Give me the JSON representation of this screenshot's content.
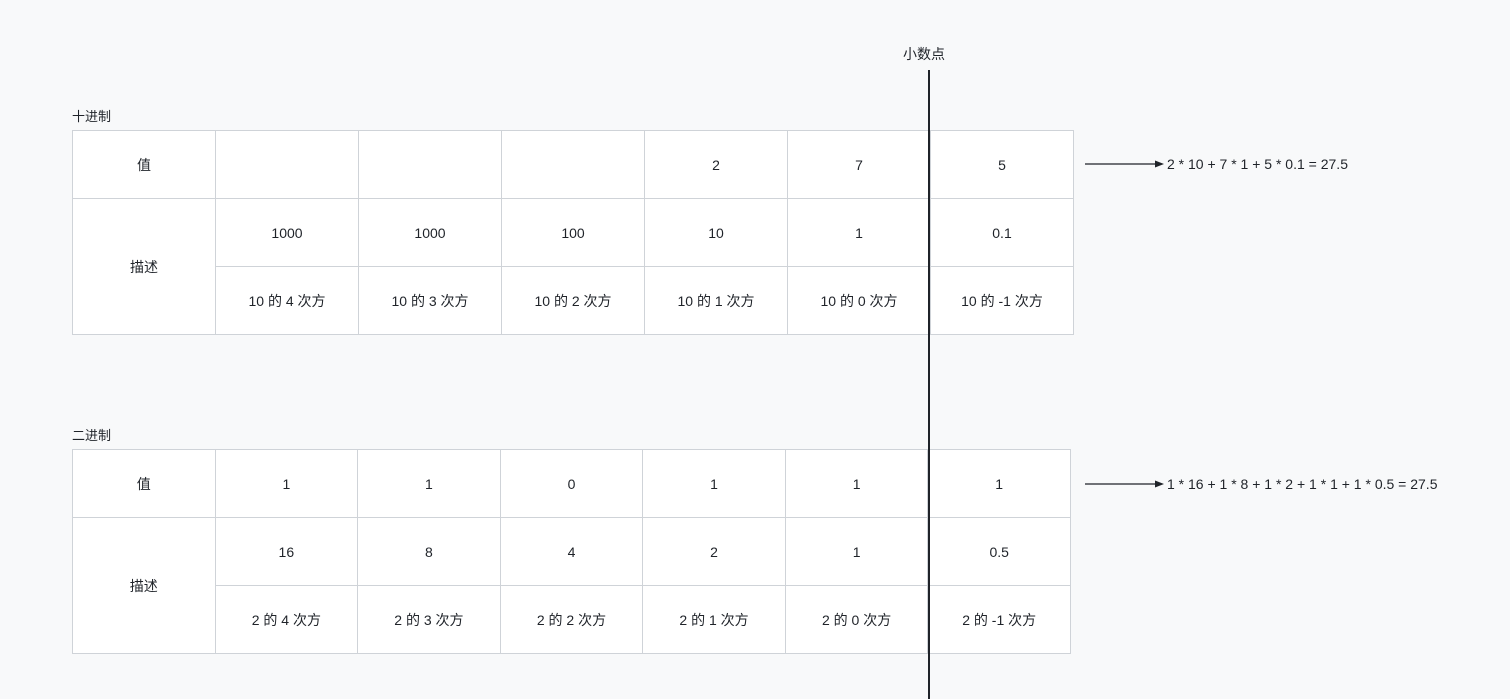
{
  "decimal_point_label": "小数点",
  "decimal": {
    "title": "十进制",
    "row_value_label": "值",
    "row_desc_label": "描述",
    "values": [
      "",
      "",
      "",
      "2",
      "7",
      "5"
    ],
    "weights": [
      "1000",
      "1000",
      "100",
      "10",
      "1",
      "0.1"
    ],
    "powers": [
      "10 的 4 次方",
      "10 的 3 次方",
      "10 的 2 次方",
      "10 的 1 次方",
      "10 的 0 次方",
      "10 的 -1 次方"
    ],
    "formula": "2 * 10 + 7 * 1 + 5 * 0.1 = 27.5"
  },
  "binary": {
    "title": "二进制",
    "row_value_label": "值",
    "row_desc_label": "描述",
    "values": [
      "1",
      "1",
      "0",
      "1",
      "1",
      "1"
    ],
    "weights": [
      "16",
      "8",
      "4",
      "2",
      "1",
      "0.5"
    ],
    "powers": [
      "2 的 4 次方",
      "2 的 3 次方",
      "2 的 2 次方",
      "2 的 1 次方",
      "2 的 0 次方",
      "2 的 -1 次方"
    ],
    "formula": "1 * 16 + 1 * 8 + 1 * 2 + 1 * 1 + 1 * 0.5 = 27.5"
  },
  "colors": {
    "line": "#1f2329",
    "border": "#cfd3d8",
    "background": "#f8f9fa"
  }
}
